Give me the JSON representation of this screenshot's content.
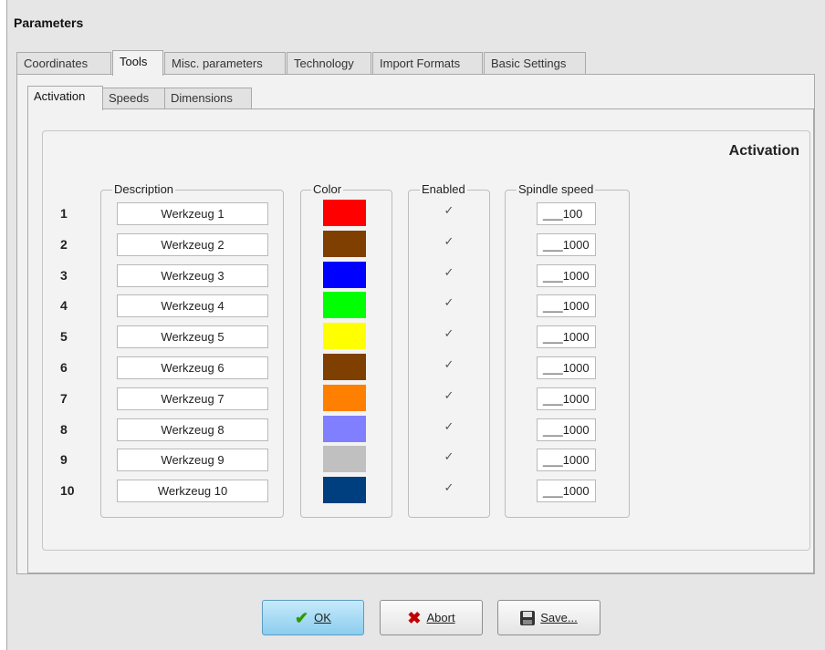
{
  "window": {
    "title": "Parameters"
  },
  "tabs": [
    {
      "label": "Coordinates",
      "active": false
    },
    {
      "label": "Tools",
      "active": true
    },
    {
      "label": "Misc. parameters",
      "active": false
    },
    {
      "label": "Technology",
      "active": false
    },
    {
      "label": "Import Formats",
      "active": false
    },
    {
      "label": "Basic Settings",
      "active": false
    }
  ],
  "subtabs": [
    {
      "label": "Activation",
      "active": true
    },
    {
      "label": "Speeds",
      "active": false
    },
    {
      "label": "Dimensions",
      "active": false
    }
  ],
  "activation": {
    "heading": "Activation",
    "col_description": "Description",
    "col_color": "Color",
    "col_enabled": "Enabled",
    "col_spindle": "Spindle speed",
    "rows": [
      {
        "num": "1",
        "description": "Werkzeug 1",
        "color": "#ff0000",
        "enabled": true,
        "speed": "___100"
      },
      {
        "num": "2",
        "description": "Werkzeug 2",
        "color": "#7f3f00",
        "enabled": true,
        "speed": "___1000"
      },
      {
        "num": "3",
        "description": "Werkzeug 3",
        "color": "#0000ff",
        "enabled": true,
        "speed": "___1000"
      },
      {
        "num": "4",
        "description": "Werkzeug 4",
        "color": "#00ff00",
        "enabled": true,
        "speed": "___1000"
      },
      {
        "num": "5",
        "description": "Werkzeug 5",
        "color": "#ffff00",
        "enabled": true,
        "speed": "___1000"
      },
      {
        "num": "6",
        "description": "Werkzeug 6",
        "color": "#7f3f00",
        "enabled": true,
        "speed": "___1000"
      },
      {
        "num": "7",
        "description": "Werkzeug 7",
        "color": "#ff7f00",
        "enabled": true,
        "speed": "___1000"
      },
      {
        "num": "8",
        "description": "Werkzeug 8",
        "color": "#7f7fff",
        "enabled": true,
        "speed": "___1000"
      },
      {
        "num": "9",
        "description": "Werkzeug 9",
        "color": "#c0c0c0",
        "enabled": true,
        "speed": "___1000"
      },
      {
        "num": "10",
        "description": "Werkzeug 10",
        "color": "#003f7f",
        "enabled": true,
        "speed": "___1000"
      }
    ]
  },
  "buttons": {
    "ok": {
      "label": "OK",
      "icon": "checkmark-icon",
      "icon_color": "#2e9a00"
    },
    "abort": {
      "label": "Abort",
      "icon": "x-icon",
      "icon_color": "#c40000"
    },
    "save": {
      "label": "Save...",
      "icon": "floppy-disk-icon"
    }
  }
}
